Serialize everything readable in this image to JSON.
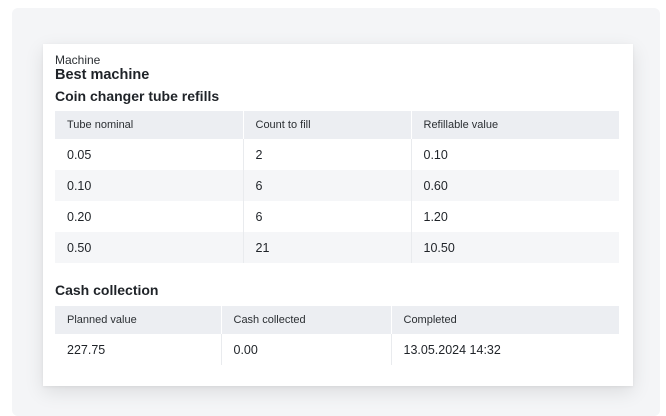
{
  "machine": {
    "label": "Machine",
    "name": "Best machine"
  },
  "refills": {
    "title": "Coin changer tube refills",
    "columns": [
      "Tube nominal",
      "Count to fill",
      "Refillable value"
    ],
    "rows": [
      [
        "0.05",
        "2",
        "0.10"
      ],
      [
        "0.10",
        "6",
        "0.60"
      ],
      [
        "0.20",
        "6",
        "1.20"
      ],
      [
        "0.50",
        "21",
        "10.50"
      ]
    ]
  },
  "cash": {
    "title": "Cash collection",
    "columns": [
      "Planned value",
      "Cash collected",
      "Completed"
    ],
    "rows": [
      [
        "227.75",
        "0.00",
        "13.05.2024 14:32"
      ]
    ]
  }
}
